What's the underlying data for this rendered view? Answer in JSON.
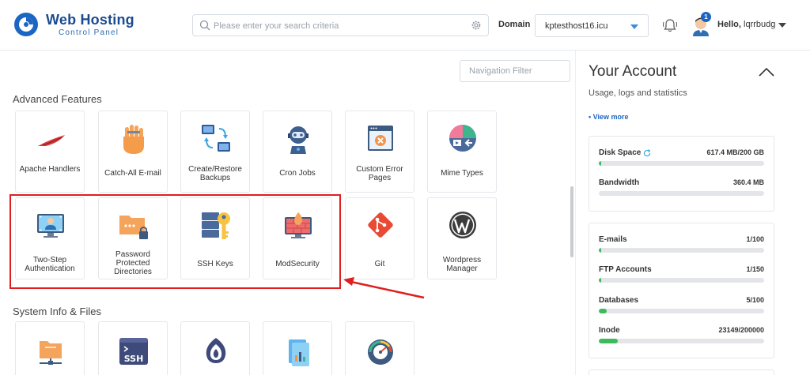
{
  "brand": {
    "title": "Web Hosting",
    "subtitle": "Control Panel"
  },
  "search": {
    "placeholder": "Please enter your search criteria"
  },
  "domain": {
    "label": "Domain",
    "value": "kptesthost16.icu"
  },
  "notifications": {
    "count": "1"
  },
  "user": {
    "greeting": "Hello,",
    "name": "lqrrbudg"
  },
  "navigation_filter": {
    "placeholder": "Navigation Filter"
  },
  "sections": {
    "advanced": {
      "title": "Advanced Features",
      "tiles": [
        {
          "label": "Apache Handlers",
          "icon": "feather-icon"
        },
        {
          "label": "Catch-All E-mail",
          "icon": "hand-icon"
        },
        {
          "label": "Create/Restore Backups",
          "icon": "backup-icon"
        },
        {
          "label": "Cron Jobs",
          "icon": "robot-icon"
        },
        {
          "label": "Custom Error Pages",
          "icon": "error-page-icon"
        },
        {
          "label": "Mime Types",
          "icon": "media-icon"
        },
        {
          "label": "Two-Step Authentication",
          "icon": "two-step-icon"
        },
        {
          "label": "Password Protected Directories",
          "icon": "locked-folder-icon"
        },
        {
          "label": "SSH Keys",
          "icon": "key-icon"
        },
        {
          "label": "ModSecurity",
          "icon": "firewall-icon"
        },
        {
          "label": "Git",
          "icon": "git-icon"
        },
        {
          "label": "Wordpress Manager",
          "icon": "wordpress-icon"
        }
      ]
    },
    "system": {
      "title": "System Info & Files",
      "tiles": [
        {
          "icon": "network-folder-icon"
        },
        {
          "icon": "ssh-terminal-icon"
        },
        {
          "icon": "tor-icon"
        },
        {
          "icon": "file-stats-icon"
        },
        {
          "icon": "speedometer-icon"
        }
      ]
    }
  },
  "account": {
    "title": "Your Account",
    "subtitle": "Usage, logs and statistics",
    "view_more": "View more",
    "resources": [
      {
        "label": "Disk Space",
        "value": "617.4 MB/200 GB",
        "fraction": 0.003
      },
      {
        "label": "Bandwidth",
        "value": "360.4 MB",
        "fraction": 0.0
      }
    ],
    "limits": [
      {
        "label": "E-mails",
        "value": "1/100",
        "fraction": 0.01
      },
      {
        "label": "FTP Accounts",
        "value": "1/150",
        "fraction": 0.007
      },
      {
        "label": "Databases",
        "value": "5/100",
        "fraction": 0.05
      },
      {
        "label": "Inode",
        "value": "23149/200000",
        "fraction": 0.116
      }
    ]
  },
  "colors": {
    "brand": "#1b4b8f",
    "accent": "#1c66c3",
    "highlight": "#e01e1e",
    "progress": "#3dbb5a"
  }
}
